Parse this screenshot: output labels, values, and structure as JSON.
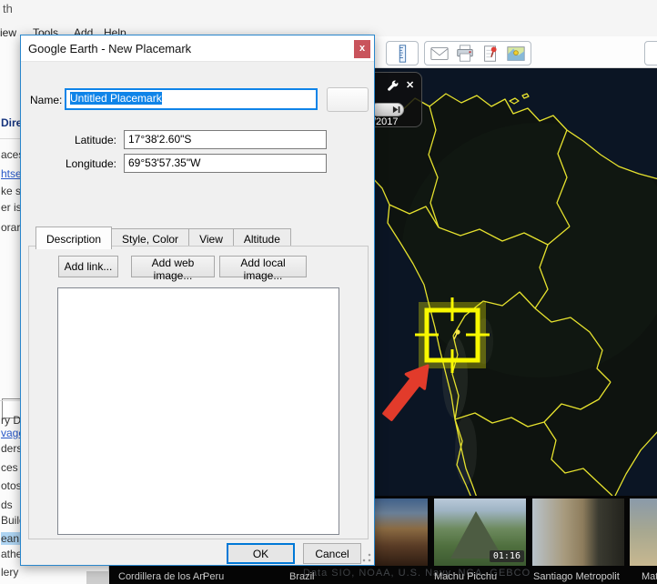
{
  "window": {
    "title_fragment": "th",
    "menu_items": [
      "iew",
      "Tools",
      "Add",
      "Help"
    ]
  },
  "sidebar": {
    "fragments": [
      {
        "text": "Dire"
      },
      {
        "text": "aces"
      },
      {
        "text": "htse"
      },
      {
        "text": "ke su"
      },
      {
        "text": "er is"
      },
      {
        "text": "orar"
      },
      {
        "text": "ry D"
      },
      {
        "text": "vage"
      },
      {
        "text": "ders"
      },
      {
        "text": "ces"
      },
      {
        "text": "otos"
      },
      {
        "text": "ds"
      },
      {
        "text": "Build"
      },
      {
        "text": "ean"
      },
      {
        "text": "athe"
      },
      {
        "text": "lery"
      }
    ]
  },
  "toolbar": {
    "icons": [
      "ruler-icon",
      "email-icon",
      "print-icon",
      "save-image-icon",
      "view-in-maps-icon"
    ]
  },
  "dialog": {
    "title": "Google Earth - New Placemark",
    "close_label": "x",
    "name_label": "Name:",
    "name_value": "Untitled Placemark",
    "latitude_label": "Latitude:",
    "latitude_value": "17°38'2.60\"S",
    "longitude_label": "Longitude:",
    "longitude_value": "69°53'57.35\"W",
    "tabs": [
      "Description",
      "Style, Color",
      "View",
      "Altitude"
    ],
    "active_tab": "Description",
    "add_link_label": "Add link...",
    "add_web_image_label": "Add web image...",
    "add_local_image_label": "Add local image...",
    "description_value": "",
    "ok_label": "OK",
    "cancel_label": "Cancel"
  },
  "map": {
    "time_panel": {
      "close_label": "✕",
      "year_fragment": "/2017"
    },
    "attribution": "Data SIO, NOAA, U.S. Navy, NGA, GEBCO",
    "border_color": "#e6e22e",
    "selection_box_color": "#f8f800",
    "arrow_color": "#e23b2b"
  },
  "photo_strip": {
    "captions_left": [
      "Cordillera de los An",
      "Peru",
      "Brazil"
    ],
    "thumbnails": [
      {
        "caption": "Machu Picchu",
        "badge": "01:16"
      },
      {
        "caption": "Santiago Metropolit"
      },
      {
        "caption": "Mat"
      }
    ]
  }
}
